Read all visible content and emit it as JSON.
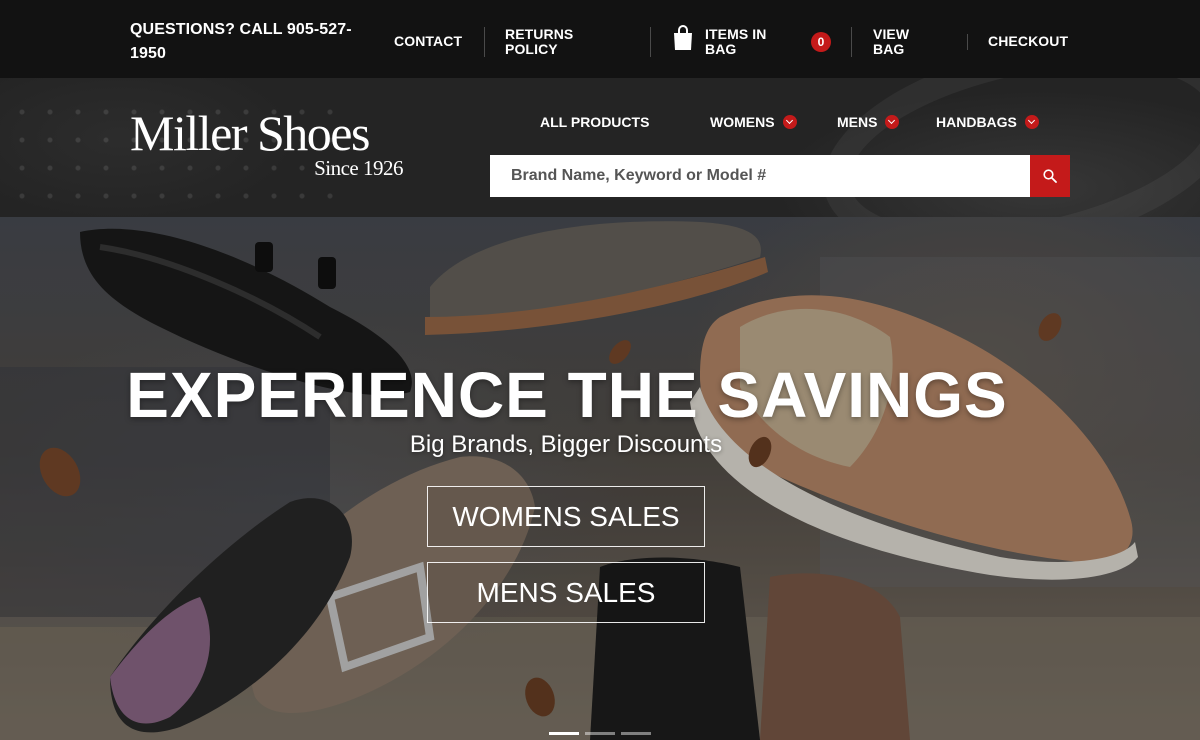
{
  "topbar": {
    "phone": "QUESTIONS? CALL 905-527-1950",
    "contact": "CONTACT",
    "returns": "RETURNS POLICY",
    "items_in_bag_label": "ITEMS IN BAG",
    "bag_count": "0",
    "view_bag": "VIEW BAG",
    "checkout": "CHECKOUT"
  },
  "header": {
    "logo_name": "Miller Shoes",
    "logo_tagline": "Since 1926",
    "nav": {
      "all_products": "ALL PRODUCTS",
      "womens": "WOMENS",
      "mens": "MENS",
      "handbags": "HANDBAGS"
    },
    "search": {
      "placeholder": "Brand Name, Keyword or Model #"
    }
  },
  "hero": {
    "headline": "EXPERIENCE THE SAVINGS",
    "subheadline": "Big Brands, Bigger Discounts",
    "cta_womens": "WOMENS SALES",
    "cta_mens": "MENS SALES",
    "slider_active_index": 1,
    "slider_count": 3
  },
  "colors": {
    "accent": "#c41a1a",
    "topbar_bg": "#121212",
    "header_bg": "#242424"
  },
  "icons": {
    "bag": "shopping-bag-icon",
    "search": "search-icon",
    "chevron": "chevron-down-icon"
  }
}
